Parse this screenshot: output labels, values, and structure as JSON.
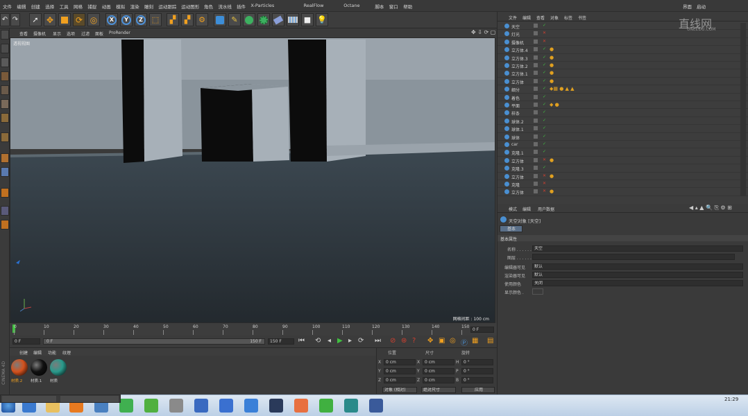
{
  "menubar": {
    "items": [
      "文件",
      "编辑",
      "创建",
      "选择",
      "工具",
      "网格",
      "捕捉",
      "动画",
      "模拟",
      "渲染",
      "雕刻",
      "运动跟踪",
      "运动图形",
      "角色",
      "流水线",
      "插件",
      "X-Particles",
      "RealFlow",
      "Octane",
      "脚本",
      "窗口",
      "帮助"
    ],
    "right": [
      "界面",
      "启动"
    ]
  },
  "toolbar": {
    "icons": [
      "undo-icon",
      "redo-icon",
      "select-cursor-icon",
      "move-icon",
      "scale-icon",
      "rotate-icon",
      "rotate-alt-icon",
      "x-axis-icon",
      "y-axis-icon",
      "z-axis-icon",
      "coord-system-icon",
      "render-view-icon",
      "render-picture-icon",
      "render-settings-icon",
      "cube-icon",
      "pen-icon",
      "subdivision-icon",
      "array-icon",
      "deformer-icon",
      "floor-icon",
      "camera-icon",
      "light-icon"
    ]
  },
  "viewport": {
    "menu": [
      "查看",
      "摄像机",
      "显示",
      "选项",
      "过滤",
      "面板",
      "ProRender"
    ],
    "label": "透视视图",
    "grid_spacing": "网格间距 : 100 cm"
  },
  "timeline": {
    "ticks": [
      "0",
      "10",
      "20",
      "30",
      "40",
      "50",
      "60",
      "70",
      "80",
      "90",
      "100",
      "110",
      "120",
      "130",
      "140",
      "150"
    ],
    "current": "0 F"
  },
  "transport": {
    "start": "0 F",
    "end": "150 F",
    "range_left": "0 F",
    "range_right": "150 F"
  },
  "materials": {
    "menu": [
      "创建",
      "编辑",
      "功能",
      "纹理"
    ],
    "items": [
      {
        "label": "材质.2",
        "color": "#d4521e"
      },
      {
        "label": "材质.1",
        "color": "#111111"
      },
      {
        "label": "材质",
        "color": "#2a9a8c"
      }
    ]
  },
  "coords": {
    "headers": [
      "位置",
      "尺寸",
      "旋转"
    ],
    "rows": [
      {
        "a": "X",
        "av": "0 cm",
        "b": "X",
        "bv": "0 cm",
        "c": "H",
        "cv": "0 °"
      },
      {
        "a": "Y",
        "av": "0 cm",
        "b": "Y",
        "bv": "0 cm",
        "c": "P",
        "cv": "0 °"
      },
      {
        "a": "Z",
        "av": "0 cm",
        "b": "Z",
        "bv": "0 cm",
        "c": "B",
        "cv": "0 °"
      }
    ],
    "mode": "对象 (相对)",
    "size_mode": "绝对尺寸",
    "apply": "应用"
  },
  "objmgr": {
    "menu": [
      "文件",
      "编辑",
      "查看",
      "对象",
      "标签",
      "书签"
    ],
    "objects": [
      {
        "name": "天空",
        "tags": ""
      },
      {
        "name": "灯光",
        "tags": ""
      },
      {
        "name": "摄像机",
        "tags": ""
      },
      {
        "name": "立方体.4",
        "tags": "●"
      },
      {
        "name": "立方体.3",
        "tags": "●"
      },
      {
        "name": "立方体.2",
        "tags": "●"
      },
      {
        "name": "立方体.1",
        "tags": "●"
      },
      {
        "name": "立方体",
        "tags": "●"
      },
      {
        "name": "细分",
        "tags": "◆▦ ● ▲ ▲"
      },
      {
        "name": "着色",
        "tags": ""
      },
      {
        "name": "平面",
        "tags": "◆ ●"
      },
      {
        "name": "样条",
        "tags": ""
      },
      {
        "name": "球体.2",
        "tags": ""
      },
      {
        "name": "球体.1",
        "tags": ""
      },
      {
        "name": "球体",
        "tags": ""
      },
      {
        "name": "car",
        "tags": ""
      },
      {
        "name": "克隆.1",
        "tags": ""
      },
      {
        "name": "立方体",
        "tags": "●"
      },
      {
        "name": "克隆.3",
        "tags": ""
      },
      {
        "name": "立方体",
        "tags": "●"
      },
      {
        "name": "克隆",
        "tags": ""
      },
      {
        "name": "立方体",
        "tags": "●"
      }
    ]
  },
  "attrmgr": {
    "menu": [
      "模式",
      "编辑",
      "用户数据"
    ],
    "title": "天空对象 [天空]",
    "tab": "基本",
    "section": "基本属性",
    "fields": [
      {
        "label": "名称 . . . . . .",
        "value": "天空"
      },
      {
        "label": "图层 . . . . . .",
        "value": ""
      },
      {
        "label": "编辑器可见",
        "value": "默认"
      },
      {
        "label": "渲染器可见",
        "value": "默认"
      },
      {
        "label": "使用颜色",
        "value": "关闭"
      },
      {
        "label": "显示颜色 .",
        "value": ""
      }
    ]
  },
  "watermark": {
    "main": "直线网",
    "sub": "UNEEDU.COM"
  },
  "taskbar": {
    "windows": [
      "",
      "",
      ""
    ],
    "clock": "21:29"
  },
  "brand": "CINEMA 4D"
}
